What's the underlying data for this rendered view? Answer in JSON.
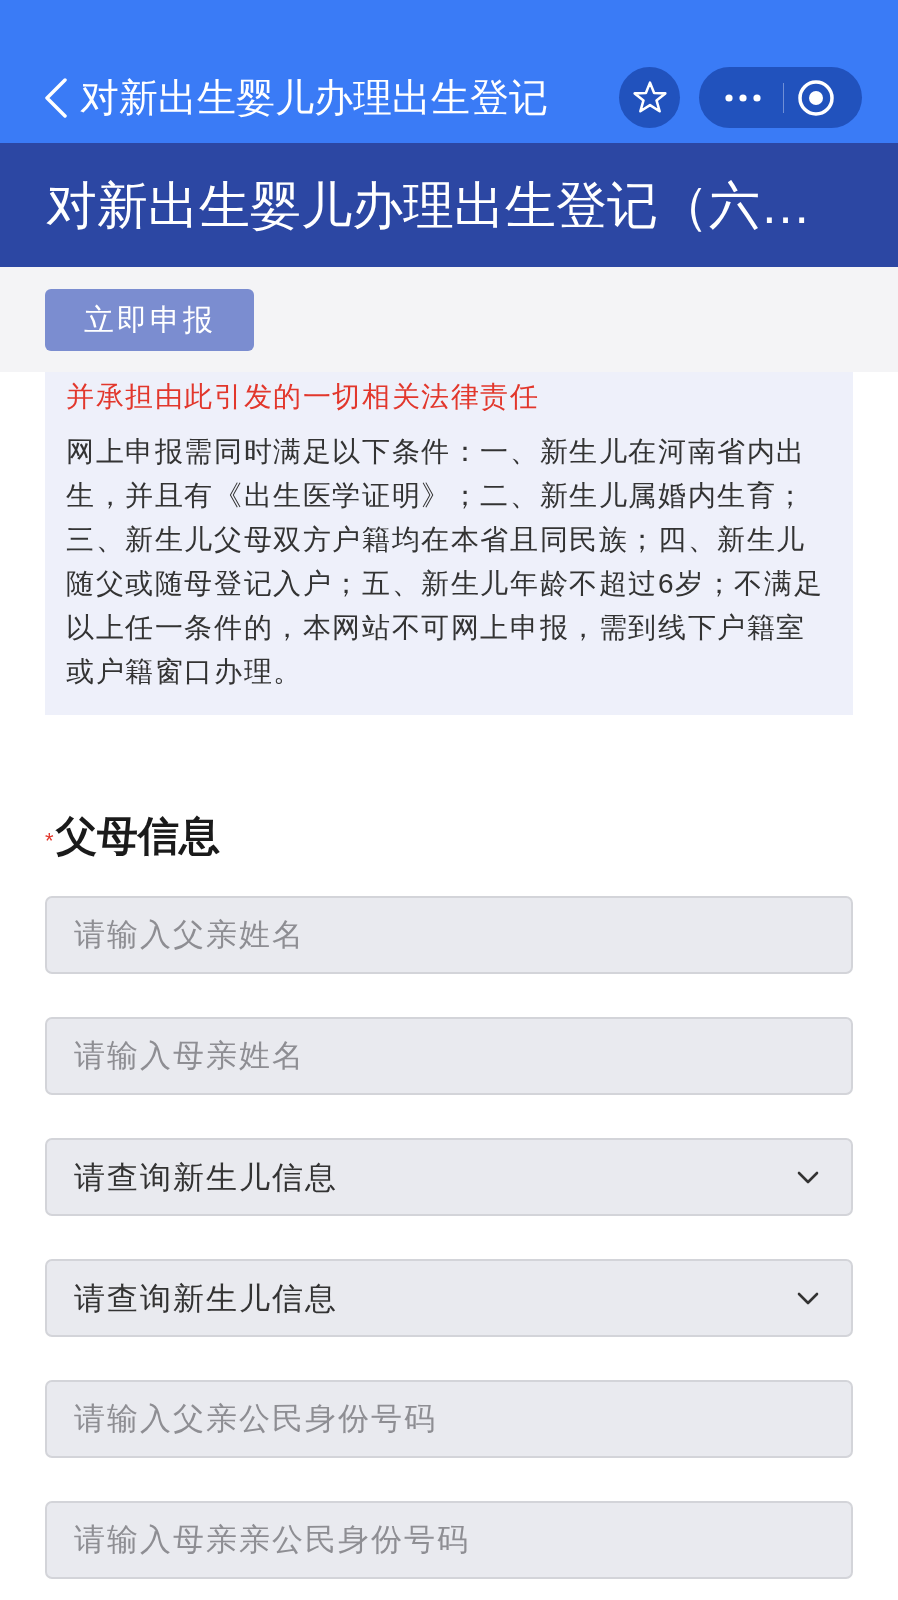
{
  "nav_bar": {
    "title": "对新出生婴儿办理出生登记"
  },
  "header": {
    "title": "对新出生婴儿办理出生登记（六…"
  },
  "action_bar": {
    "button": "立即申报"
  },
  "notice": {
    "warning": "并承担由此引发的一切相关法律责任",
    "text": "网上申报需同时满足以下条件：一、新生儿在河南省内出生，并且有《出生医学证明》；二、新生儿属婚内生育；三、新生儿父母双方户籍均在本省且同民族；四、新生儿随父或随母登记入户；五、新生儿年龄不超过6岁；不满足以上任一条件的，本网站不可网上申报，需到线下户籍室或户籍窗口办理。"
  },
  "section": {
    "required_mark": "*",
    "title": "父母信息"
  },
  "fields": [
    {
      "kind": "input",
      "placeholder": "请输入父亲姓名"
    },
    {
      "kind": "input",
      "placeholder": "请输入母亲姓名"
    },
    {
      "kind": "select",
      "value": "请查询新生儿信息"
    },
    {
      "kind": "select",
      "value": "请查询新生儿信息"
    },
    {
      "kind": "input",
      "placeholder": "请输入父亲公民身份号码"
    },
    {
      "kind": "input",
      "placeholder": "请输入母亲亲公民身份号码"
    }
  ]
}
